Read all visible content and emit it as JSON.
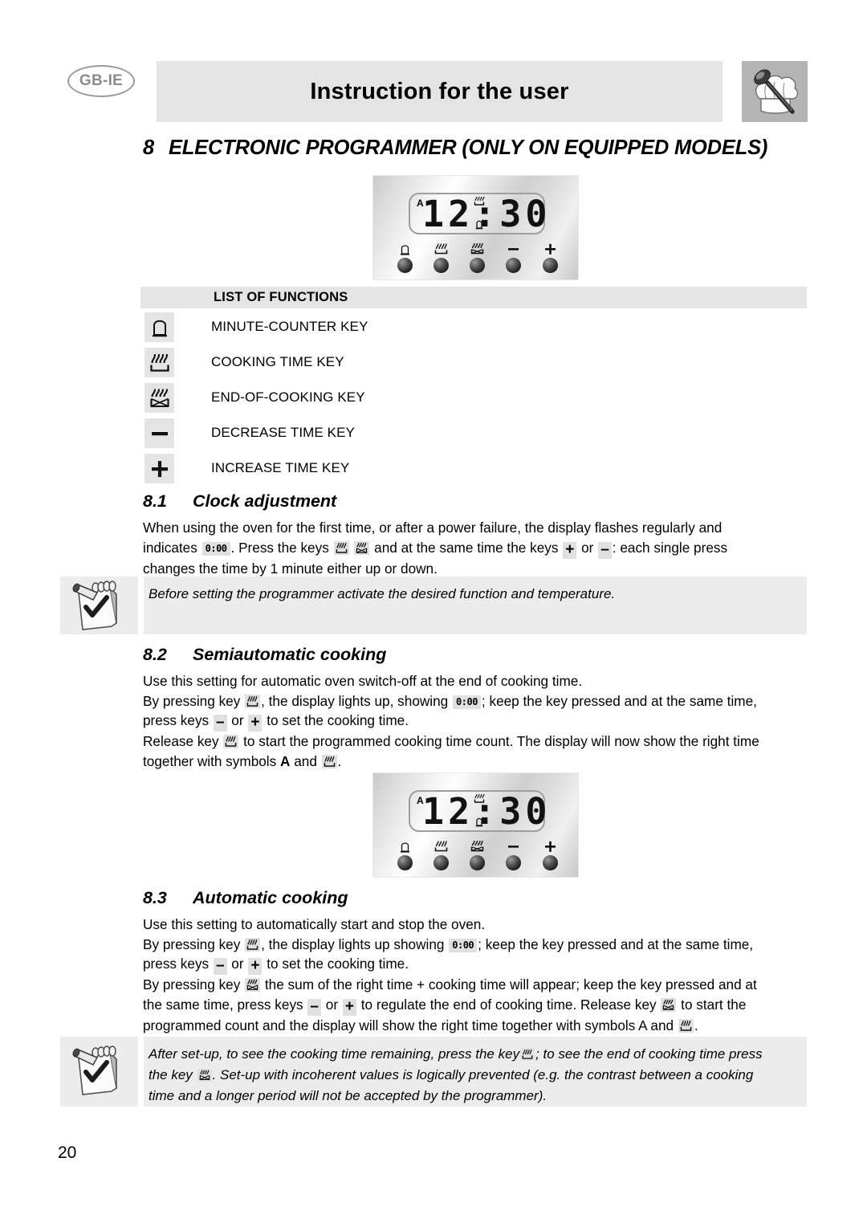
{
  "header": {
    "locale_badge": "GB-IE",
    "title": "Instruction for the user",
    "chef_icon": "chef-hat-spoon-icon"
  },
  "section": {
    "number": "8",
    "title": "ELECTRONIC PROGRAMMER (ONLY ON EQUIPPED MODELS)"
  },
  "programmer_display": {
    "indicator": "A",
    "time": "12:30",
    "top_symbol": "cooking-time-icon",
    "bottom_symbol": "minute-counter-icon",
    "buttons": [
      {
        "icon": "minute-counter-icon",
        "name": "minute-counter-key"
      },
      {
        "icon": "cooking-time-icon",
        "name": "cooking-time-key"
      },
      {
        "icon": "end-of-cooking-icon",
        "name": "end-of-cooking-key"
      },
      {
        "icon": "minus-icon",
        "name": "decrease-time-key"
      },
      {
        "icon": "plus-icon",
        "name": "increase-time-key"
      }
    ]
  },
  "list_of_functions": {
    "heading": "LIST OF FUNCTIONS",
    "rows": [
      {
        "icon": "minute-counter-icon",
        "label": "MINUTE-COUNTER KEY"
      },
      {
        "icon": "cooking-time-icon",
        "label": "COOKING TIME KEY"
      },
      {
        "icon": "end-of-cooking-icon",
        "label": "END-OF-COOKING KEY"
      },
      {
        "icon": "minus-icon",
        "label": "DECREASE TIME KEY"
      },
      {
        "icon": "plus-icon",
        "label": "INCREASE TIME KEY"
      }
    ]
  },
  "sub_8_1": {
    "number": "8.1",
    "title": "Clock adjustment",
    "line1": "When using the oven for the first time, or after a power failure, the display flashes regularly and",
    "line2_a": "indicates",
    "line2_inline_time": "0:00",
    "line2_b": ". Press the keys",
    "line2_c": "and at the same time the keys",
    "line2_plus": "+",
    "line2_d": "or",
    "line2_minus": "–",
    "line2_e": ": each single press",
    "line3": "changes the time by 1 minute either up or down."
  },
  "note_1": {
    "icon": "notepad-pencil-icon",
    "text": "Before setting the programmer activate the desired function and temperature."
  },
  "sub_8_2": {
    "number": "8.2",
    "title": "Semiautomatic cooking",
    "line1": "Use this setting for automatic oven switch-off at the end of cooking time.",
    "line2_a": "By pressing key",
    "line2_b": ", the display lights up, showing",
    "line2_time": "0:00",
    "line2_c": "; keep the key pressed and at the same time,",
    "line3_a": "press keys",
    "line3_minus": "–",
    "line3_or": "or",
    "line3_plus": "+",
    "line3_b": "to set the cooking time.",
    "line4_a": "Release key",
    "line4_b": "to start the programmed cooking time count. The display will now show the right time",
    "line5_a": "together with symbols",
    "line5_A": "A",
    "line5_b": "and",
    "line5_c": "."
  },
  "sub_8_3": {
    "number": "8.3",
    "title": "Automatic cooking",
    "line1": "Use this setting to automatically start and stop the oven.",
    "line2_a": "By pressing key",
    "line2_b": ", the display lights up showing",
    "line2_time": "0:00",
    "line2_c": "; keep the key pressed and at the same time,",
    "line3_a": "press keys",
    "line3_minus": "–",
    "line3_or": "or",
    "line3_plus": "+",
    "line3_b": "to set the cooking time.",
    "line4_a": "By pressing key",
    "line4_b": "the sum of the right time + cooking time will appear; keep the key pressed and at",
    "line5_a": "the same time, press keys",
    "line5_minus": "–",
    "line5_or": "or",
    "line5_plus": "+",
    "line5_b": "to regulate the end of cooking time. Release key",
    "line5_c": "to start the",
    "line6_a": "programmed count and the display will show the right time together with symbols A and",
    "line6_b": "."
  },
  "note_2": {
    "icon": "notepad-pencil-icon",
    "line1_a": "After set-up, to see the cooking time remaining, press the key",
    "line1_b": "; to see the end of cooking time press",
    "line2_a": "the key",
    "line2_b": ". Set-up with incoherent values is logically prevented (e.g. the contrast between a cooking",
    "line3": "time and a longer period will not be accepted by the programmer)."
  },
  "footer": {
    "page_number": "20"
  }
}
